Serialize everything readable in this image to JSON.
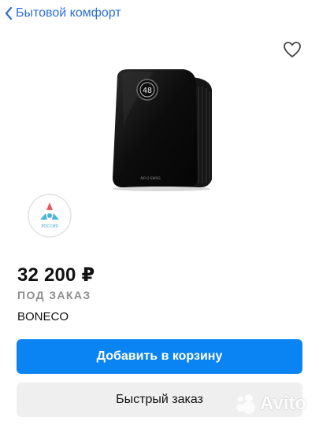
{
  "header": {
    "back_label": "Бытовой комфорт"
  },
  "product": {
    "price": "32 200 ₽",
    "availability": "ПОД ЗАКАЗ",
    "brand": "BONECO",
    "display_value": "48",
    "device_label": "AIR-O-SWISS",
    "badge_text": "РОССИЯ"
  },
  "actions": {
    "add_to_cart": "Добавить в корзину",
    "quick_order": "Быстрый заказ"
  },
  "watermark": {
    "text": "Avito"
  },
  "colors": {
    "accent": "#0a84f2",
    "link": "#2a6fdb",
    "muted": "#8e8e8e"
  },
  "icons": {
    "back": "chevron-left-icon",
    "favorite": "heart-outline-icon"
  }
}
